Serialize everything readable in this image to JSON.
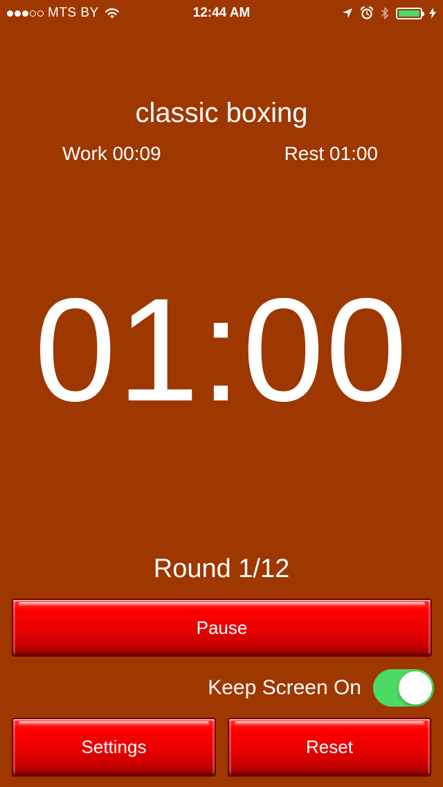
{
  "status_bar": {
    "carrier": "MTS BY",
    "time": "12:44 AM",
    "signal_bars_full": 3,
    "signal_bars_total": 5,
    "battery_level": 1.0,
    "battery_color": "#4cd964",
    "icons": [
      "wifi-icon",
      "location-arrow-icon",
      "alarm-icon",
      "bluetooth-icon",
      "battery-icon",
      "charging-bolt-icon"
    ]
  },
  "timer": {
    "preset_name": "classic boxing",
    "work_label": "Work 00:09",
    "rest_label": "Rest 01:00",
    "time": "01:00",
    "round_label": "Round 1/12"
  },
  "controls": {
    "pause_label": "Pause",
    "keep_screen_label": "Keep Screen On",
    "keep_screen_on": true,
    "settings_label": "Settings",
    "reset_label": "Reset"
  },
  "colors": {
    "background": "#9e3700",
    "button_red": "#e80000",
    "toggle_on": "#4cd964"
  }
}
